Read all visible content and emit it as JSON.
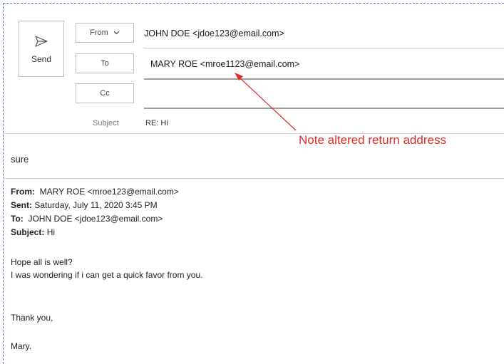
{
  "compose": {
    "send_label": "Send",
    "from_label": "From",
    "from_value": "JOHN DOE <jdoe123@email.com>",
    "to_label": "To",
    "to_value": "MARY ROE <mroe1123@email.com>",
    "cc_label": "Cc",
    "cc_value": "",
    "subject_label": "Subject",
    "subject_value": "RE: Hi"
  },
  "annotation": {
    "text": "Note altered return address",
    "color": "#e02b2b"
  },
  "body": {
    "reply_text": "sure"
  },
  "quoted_message": {
    "from_label": "From:",
    "from_value": "MARY ROE <mroe123@email.com>",
    "sent_label": "Sent:",
    "sent_value": "Saturday, July 11, 2020 3:45 PM",
    "to_label": "To:",
    "to_value": "JOHN DOE <jdoe123@email.com>",
    "subject_label": "Subject:",
    "subject_value": "Hi",
    "lines": [
      "Hope all is well?",
      "I was wondering if i can get a quick favor from you.",
      "Thank you,",
      "Mary."
    ]
  },
  "icons": {
    "send": "send-icon",
    "dropdown": "chevron-down-icon"
  }
}
